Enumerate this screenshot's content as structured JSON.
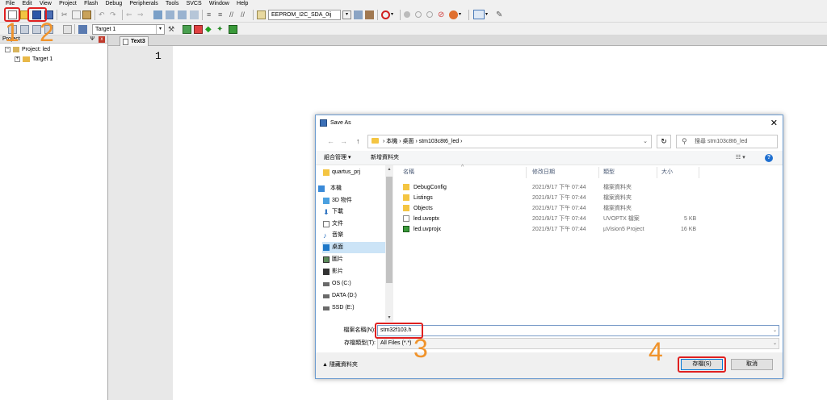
{
  "menu": [
    "File",
    "Edit",
    "View",
    "Project",
    "Flash",
    "Debug",
    "Peripherals",
    "Tools",
    "SVCS",
    "Window",
    "Help"
  ],
  "toolbar": {
    "config_combo": "EEPROM_I2C_SDA_0ij",
    "target_combo": "Target 1"
  },
  "project_panel": {
    "title": "Project",
    "pin": "Ѱ",
    "close": "x",
    "root": "Project: led",
    "target": "Target 1"
  },
  "editor": {
    "tab": "Text3",
    "line_number": "1"
  },
  "annotations": {
    "step1": "1",
    "step2": "2",
    "step3": "3",
    "step4": "4"
  },
  "dialog": {
    "title": "Save As",
    "close": "✕",
    "nav": {
      "back": "←",
      "forward": "→",
      "up": "↑",
      "refresh": "↻"
    },
    "path": "› 本機 › 桌面 › stm103c8t6_led ›",
    "search_placeholder": "搜尋 stm103c8t6_led",
    "organize": "組合管理 ▾",
    "new_folder": "新增資料夾",
    "view_icon": "☷ ▾",
    "help": "?",
    "nav_items": [
      {
        "label": "quartus_prj",
        "icon": "folder-icon"
      },
      {
        "label": "本機",
        "icon": "computer-icon"
      },
      {
        "label": "3D 物件",
        "icon": "3d-objects-icon"
      },
      {
        "label": "下載",
        "icon": "download-icon"
      },
      {
        "label": "文件",
        "icon": "documents-icon"
      },
      {
        "label": "音樂",
        "icon": "music-icon"
      },
      {
        "label": "桌面",
        "icon": "desktop-icon"
      },
      {
        "label": "圖片",
        "icon": "pictures-icon"
      },
      {
        "label": "影片",
        "icon": "videos-icon"
      },
      {
        "label": "OS (C:)",
        "icon": "drive-icon"
      },
      {
        "label": "DATA (D:)",
        "icon": "drive-icon"
      },
      {
        "label": "SSD (E:)",
        "icon": "drive-icon"
      }
    ],
    "columns": {
      "name": "名稱",
      "date": "修改日期",
      "type": "類型",
      "size": "大小"
    },
    "files": [
      {
        "name": "DebugConfig",
        "date": "2021/9/17 下午 07:44",
        "type": "檔案資料夾",
        "size": "",
        "icon": "folder-icon"
      },
      {
        "name": "Listings",
        "date": "2021/9/17 下午 07:44",
        "type": "檔案資料夾",
        "size": "",
        "icon": "folder-icon"
      },
      {
        "name": "Objects",
        "date": "2021/9/17 下午 07:44",
        "type": "檔案資料夾",
        "size": "",
        "icon": "folder-icon"
      },
      {
        "name": "led.uvoptx",
        "date": "2021/9/17 下午 07:44",
        "type": "UVOPTX 檔案",
        "size": "5 KB",
        "icon": "file-icon"
      },
      {
        "name": "led.uvprojx",
        "date": "2021/9/17 下午 07:44",
        "type": "µVision5 Project",
        "size": "16 KB",
        "icon": "uvision-project-icon"
      }
    ],
    "filename_label": "檔案名稱(N):",
    "filename_value": "stm32f103.h",
    "filetype_label": "存檔類型(T):",
    "filetype_value": "All Files (*.*)",
    "hide_folders": "▲ 隱藏資料夾",
    "save_button": "存檔(S)",
    "cancel_button": "取消"
  }
}
